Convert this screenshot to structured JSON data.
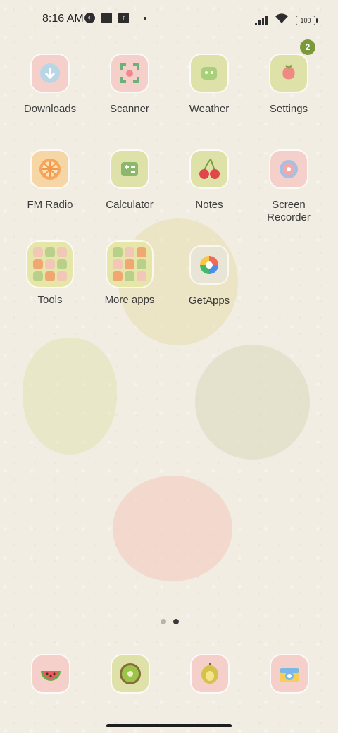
{
  "status_bar": {
    "time": "8:16 AM",
    "battery": "100"
  },
  "apps": [
    {
      "label": "Downloads",
      "icon": "download-icon"
    },
    {
      "label": "Scanner",
      "icon": "scanner-icon"
    },
    {
      "label": "Weather",
      "icon": "weather-icon"
    },
    {
      "label": "Settings",
      "icon": "settings-icon",
      "badge": "2"
    },
    {
      "label": "FM Radio",
      "icon": "radio-icon"
    },
    {
      "label": "Calculator",
      "icon": "calculator-icon"
    },
    {
      "label": "Notes",
      "icon": "cherry-icon"
    },
    {
      "label": "Screen Recorder",
      "icon": "screen-recorder-icon"
    },
    {
      "label": "Tools",
      "icon": "folder-icon"
    },
    {
      "label": "More apps",
      "icon": "folder-icon"
    },
    {
      "label": "GetApps",
      "icon": "getapps-icon"
    }
  ],
  "dock": [
    {
      "icon": "watermelon-icon"
    },
    {
      "icon": "kiwi-icon"
    },
    {
      "icon": "durian-icon"
    },
    {
      "icon": "camera-icon"
    }
  ],
  "page_indicator": {
    "pages": 2,
    "current": 2
  },
  "colors": {
    "badge": "#7a9a3a",
    "background": "#f1ede3"
  }
}
